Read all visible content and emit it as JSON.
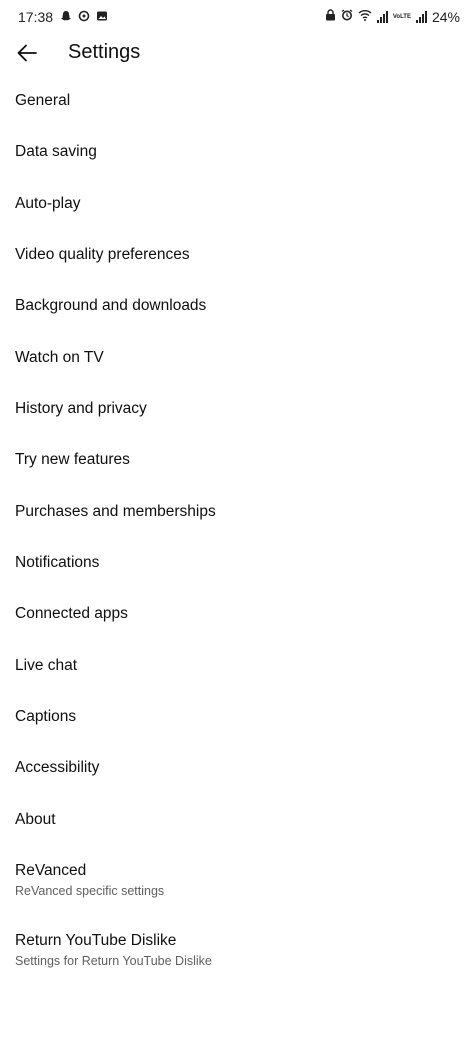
{
  "status_bar": {
    "time": "17:38",
    "battery": "24%",
    "left_icons": [
      "snapchat-icon",
      "ghost-icon",
      "gallery-icon"
    ],
    "right_icons": [
      "lock-icon",
      "alarm-icon",
      "wifi-icon",
      "signal-icon",
      "volte-icon",
      "signal-icon"
    ],
    "volte_text": "VoLTE"
  },
  "header": {
    "title": "Settings",
    "back_icon": "arrow-left-icon"
  },
  "settings": {
    "items": [
      {
        "label": "General"
      },
      {
        "label": "Data saving"
      },
      {
        "label": "Auto-play"
      },
      {
        "label": "Video quality preferences"
      },
      {
        "label": "Background and downloads"
      },
      {
        "label": "Watch on TV"
      },
      {
        "label": "History and privacy"
      },
      {
        "label": "Try new features"
      },
      {
        "label": "Purchases and memberships"
      },
      {
        "label": "Notifications"
      },
      {
        "label": "Connected apps"
      },
      {
        "label": "Live chat"
      },
      {
        "label": "Captions"
      },
      {
        "label": "Accessibility"
      },
      {
        "label": "About"
      },
      {
        "label": "ReVanced",
        "subtitle": "ReVanced specific settings"
      },
      {
        "label": "Return YouTube Dislike",
        "subtitle": "Settings for Return YouTube Dislike"
      }
    ]
  }
}
